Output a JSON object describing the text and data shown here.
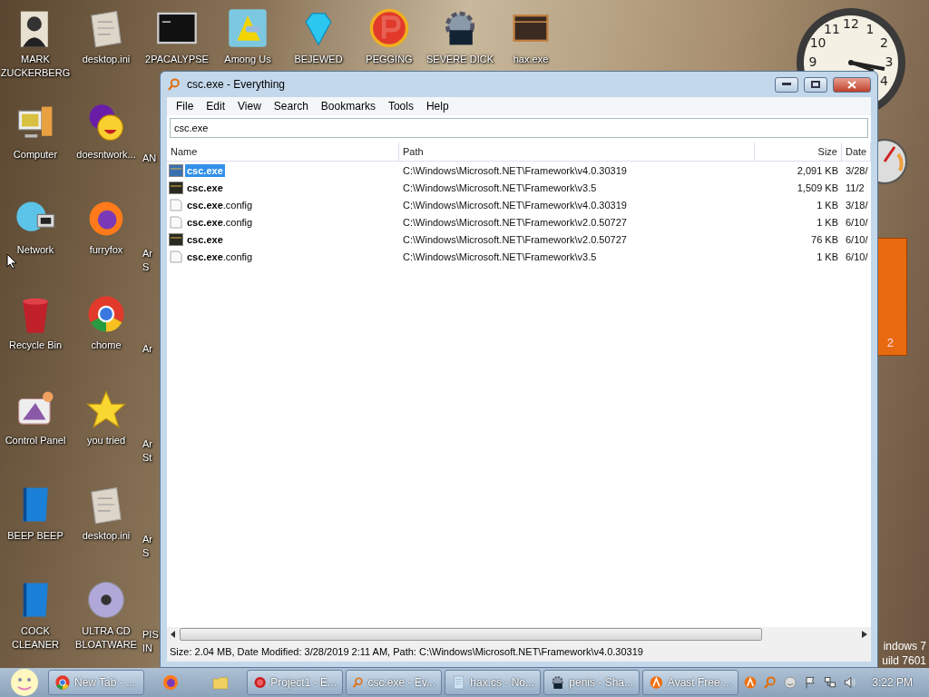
{
  "desktop": {
    "icon_columns": [
      [
        {
          "kind": "person",
          "label": "MARK ZUCKERBERG"
        },
        {
          "kind": "computer",
          "label": "Computer"
        },
        {
          "kind": "globe",
          "label": "Network"
        },
        {
          "kind": "trash",
          "label": "Recycle Bin"
        },
        {
          "kind": "control",
          "label": "Control Panel"
        },
        {
          "kind": "blue-panel",
          "label": "BEEP BEEP"
        },
        {
          "kind": "blue-panel",
          "label": "COCK CLEANER"
        }
      ],
      [
        {
          "kind": "document",
          "label": "desktop.ini"
        },
        {
          "kind": "messenger",
          "label": "doesntwork..."
        },
        {
          "kind": "firefox",
          "label": "furryfox"
        },
        {
          "kind": "chrome",
          "label": "chome"
        },
        {
          "kind": "star",
          "label": "you tried"
        },
        {
          "kind": "document",
          "label": "desktop.ini"
        },
        {
          "kind": "disc",
          "label": "ULTRA CD BLOATWARE"
        }
      ],
      [
        {
          "kind": "terminal",
          "label": "2PACALYPSE"
        },
        {
          "kind": "cut",
          "label": "AN"
        },
        {
          "kind": "cut",
          "label": "Ar S"
        },
        {
          "kind": "cut",
          "label": "Ar"
        },
        {
          "kind": "cut",
          "label": "Ar St"
        },
        {
          "kind": "cut",
          "label": "Ar S"
        },
        {
          "kind": "cut",
          "label": "PIS IN"
        }
      ],
      [
        {
          "kind": "amongus",
          "label": "Among Us"
        }
      ],
      [
        {
          "kind": "gem",
          "label": "BEJEWED"
        }
      ],
      [
        {
          "kind": "letter-p",
          "label": "PEGGING"
        }
      ],
      [
        {
          "kind": "gear",
          "label": "SEVERE DICK"
        }
      ],
      [
        {
          "kind": "film",
          "label": "hax.exe"
        }
      ]
    ],
    "clock": {
      "numerals": [
        "12",
        "1",
        "2",
        "3",
        "4",
        "9",
        "10",
        "11"
      ]
    },
    "calendar": {
      "day": "2"
    },
    "build_info": [
      "indows 7",
      "uild 7601"
    ]
  },
  "window": {
    "title": "csc.exe - Everything",
    "menu": [
      "File",
      "Edit",
      "View",
      "Search",
      "Bookmarks",
      "Tools",
      "Help"
    ],
    "search": {
      "value": "csc.exe"
    },
    "columns": [
      "Name",
      "Path",
      "Size",
      "Date"
    ],
    "rows": [
      {
        "kind": "exe",
        "selected": true,
        "name": "**csc.exe**",
        "path": "C:\\Windows\\Microsoft.NET\\Framework\\v4.0.30319",
        "size": "2,091 KB",
        "date": "3/28/"
      },
      {
        "kind": "exe",
        "selected": false,
        "name": "**csc.exe**",
        "path": "C:\\Windows\\Microsoft.NET\\Framework\\v3.5",
        "size": "1,509 KB",
        "date": "11/2"
      },
      {
        "kind": "config",
        "selected": false,
        "name": "**csc.exe**.config",
        "path": "C:\\Windows\\Microsoft.NET\\Framework\\v4.0.30319",
        "size": "1 KB",
        "date": "3/18/"
      },
      {
        "kind": "config",
        "selected": false,
        "name": "**csc.exe**.config",
        "path": "C:\\Windows\\Microsoft.NET\\Framework\\v2.0.50727",
        "size": "1 KB",
        "date": "6/10/"
      },
      {
        "kind": "exe",
        "selected": false,
        "name": "**csc.exe**",
        "path": "C:\\Windows\\Microsoft.NET\\Framework\\v2.0.50727",
        "size": "76 KB",
        "date": "6/10/"
      },
      {
        "kind": "config",
        "selected": false,
        "name": "**csc.exe**.config",
        "path": "C:\\Windows\\Microsoft.NET\\Framework\\v3.5",
        "size": "1 KB",
        "date": "6/10/"
      }
    ],
    "status_bar": "Size: 2.04 MB, Date Modified: 3/28/2019 2:11 AM, Path: C:\\Windows\\Microsoft.NET\\Framework\\v4.0.30319"
  },
  "taskbar": {
    "buttons": [
      {
        "kind": "chrome",
        "label": "New Tab - ..."
      },
      {
        "kind": "firefox"
      },
      {
        "kind": "folder"
      },
      {
        "kind": "devcpp",
        "label": "Project1 - E..."
      },
      {
        "kind": "search",
        "label": "csc.exe - Ev..."
      },
      {
        "kind": "notepad",
        "label": "hax.cs - No..."
      },
      {
        "kind": "gear",
        "label": "penis - Sha..."
      },
      {
        "kind": "avast",
        "label": "Avast Free ..."
      }
    ],
    "time": "3:22 PM"
  }
}
